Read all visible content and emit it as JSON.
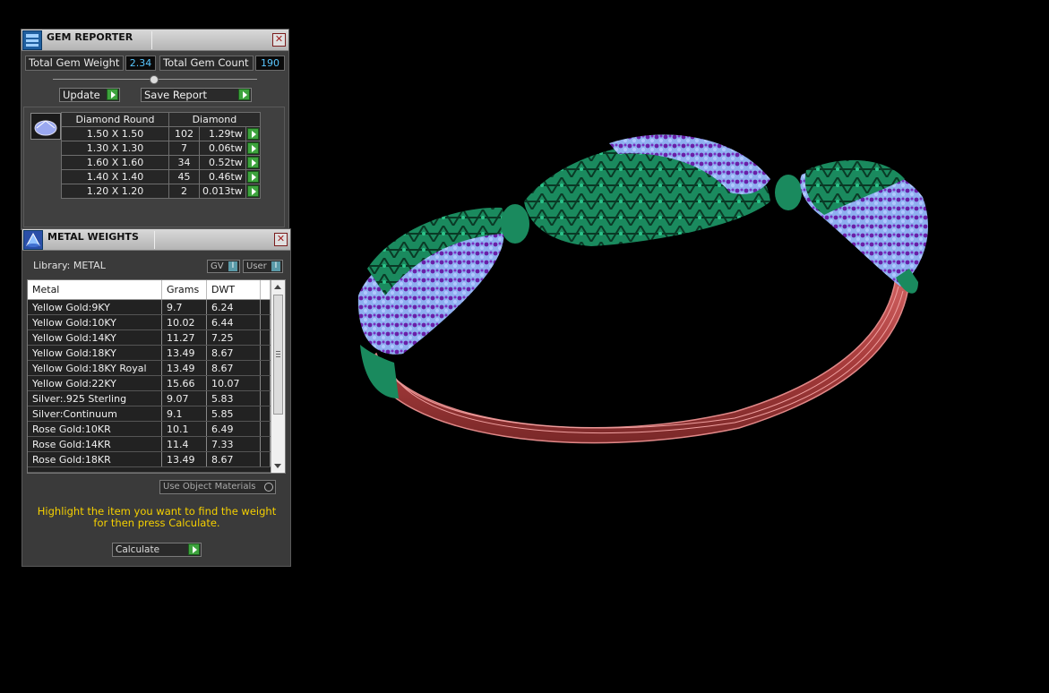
{
  "gem_reporter": {
    "title": "GEM REPORTER",
    "total_weight_label": "Total Gem Weight",
    "total_weight_value": "2.34",
    "total_count_label": "Total Gem Count",
    "total_count_value": "190",
    "update_label": "Update",
    "save_report_label": "Save Report",
    "table": {
      "col1_header": "Diamond Round",
      "col2_header": "Diamond",
      "rows": [
        {
          "size": "1.50 X 1.50",
          "count": "102",
          "weight": "1.29tw"
        },
        {
          "size": "1.30 X 1.30",
          "count": "7",
          "weight": "0.06tw"
        },
        {
          "size": "1.60 X 1.60",
          "count": "34",
          "weight": "0.52tw"
        },
        {
          "size": "1.40 X 1.40",
          "count": "45",
          "weight": "0.46tw"
        },
        {
          "size": "1.20 X 1.20",
          "count": "2",
          "weight": "0.013tw"
        }
      ]
    }
  },
  "metal_weights": {
    "title": "METAL WEIGHTS",
    "library_label": "Library: METAL",
    "gv_label": "GV",
    "user_label": "User",
    "headers": {
      "metal": "Metal",
      "grams": "Grams",
      "dwt": "DWT"
    },
    "rows": [
      {
        "metal": "Yellow Gold:9KY",
        "grams": "9.7",
        "dwt": "6.24"
      },
      {
        "metal": "Yellow Gold:10KY",
        "grams": "10.02",
        "dwt": "6.44"
      },
      {
        "metal": "Yellow Gold:14KY",
        "grams": "11.27",
        "dwt": "7.25"
      },
      {
        "metal": "Yellow Gold:18KY",
        "grams": "13.49",
        "dwt": "8.67"
      },
      {
        "metal": "Yellow Gold:18KY Royal",
        "grams": "13.49",
        "dwt": "8.67"
      },
      {
        "metal": "Yellow Gold:22KY",
        "grams": "15.66",
        "dwt": "10.07"
      },
      {
        "metal": "Silver:.925 Sterling",
        "grams": "9.07",
        "dwt": "5.83"
      },
      {
        "metal": "Silver:Continuum",
        "grams": "9.1",
        "dwt": "5.85"
      },
      {
        "metal": "Rose Gold:10KR",
        "grams": "10.1",
        "dwt": "6.49"
      },
      {
        "metal": "Rose Gold:14KR",
        "grams": "11.4",
        "dwt": "7.33"
      },
      {
        "metal": "Rose Gold:18KR",
        "grams": "13.49",
        "dwt": "8.67"
      }
    ],
    "use_object_materials_label": "Use Object Materials",
    "hint_line1": "Highlight the item you want to find the weight",
    "hint_line2": "for then press Calculate.",
    "calculate_label": "Calculate"
  },
  "colors": {
    "metal_green": "#1a8a5e",
    "gem_purple": "#6a1fa8",
    "gem_blue": "#8fb0f0",
    "shank_red": "#b84a4a",
    "hint_yellow": "#f5d000",
    "value_blue": "#59c7ff"
  }
}
